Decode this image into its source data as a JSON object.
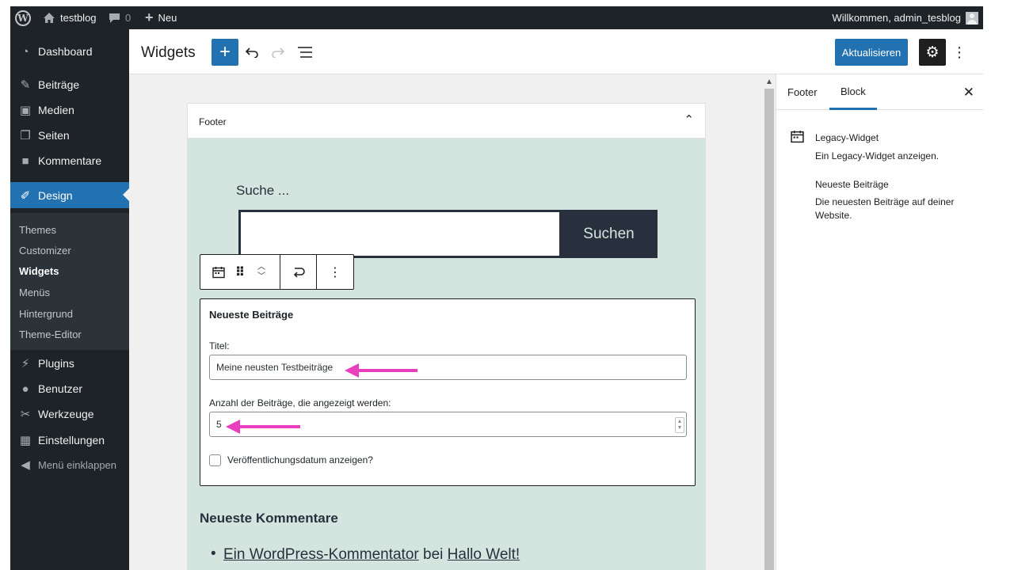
{
  "admin_bar": {
    "site_name": "testblog",
    "comments_count": "0",
    "new_label": "Neu",
    "greeting": "Willkommen, admin_tesblog"
  },
  "sidebar": {
    "items": [
      {
        "label": "Dashboard",
        "icon": "dashboard-icon"
      },
      {
        "label": "Beiträge",
        "icon": "pin-icon"
      },
      {
        "label": "Medien",
        "icon": "media-icon"
      },
      {
        "label": "Seiten",
        "icon": "pages-icon"
      },
      {
        "label": "Kommentare",
        "icon": "comment-icon"
      },
      {
        "label": "Design",
        "icon": "brush-icon"
      },
      {
        "label": "Plugins",
        "icon": "plugin-icon"
      },
      {
        "label": "Benutzer",
        "icon": "user-icon"
      },
      {
        "label": "Werkzeuge",
        "icon": "wrench-icon"
      },
      {
        "label": "Einstellungen",
        "icon": "settings-icon"
      },
      {
        "label": "Menü einklappen",
        "icon": "collapse-icon"
      }
    ],
    "submenu": [
      "Themes",
      "Customizer",
      "Widgets",
      "Menüs",
      "Hintergrund",
      "Theme-Editor"
    ],
    "current_submenu": "Widgets"
  },
  "editor": {
    "title": "Widgets",
    "update_label": "Aktualisieren"
  },
  "widget_area": {
    "title": "Footer",
    "search": {
      "label": "Suche ...",
      "button_label": "Suchen"
    },
    "form": {
      "title": "Neueste Beiträge",
      "title_field_label": "Titel:",
      "title_value": "Meine neusten Testbeiträge",
      "count_label": "Anzahl der Beiträge, die angezeigt werden:",
      "count_value": "5",
      "date_checkbox_label": "Veröffentlichungsdatum anzeigen?",
      "date_checked": false
    },
    "comments": {
      "title": "Neueste Kommentare",
      "author_link": "Ein WordPress-Kommentator",
      "separator": "bei",
      "post_link": "Hallo Welt!"
    }
  },
  "settings_panel": {
    "tabs": [
      "Footer",
      "Block"
    ],
    "active_tab": "Block",
    "block_title": "Legacy-Widget",
    "block_description": "Ein Legacy-Widget anzeigen.",
    "widget_name": "Neueste Beiträge",
    "widget_description": "Die neuesten Beiträge auf deiner Website."
  },
  "colors": {
    "accent": "#2271b1",
    "admin_dark": "#1d2327",
    "widget_area_bg": "#d4e5df",
    "annotation_arrow": "#e93ebd"
  }
}
